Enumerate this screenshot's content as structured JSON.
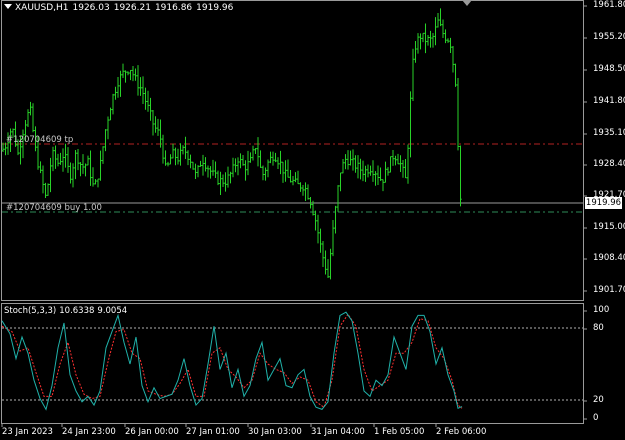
{
  "header": {
    "symbol": "XAUUSD,H1",
    "open": "1926.03",
    "high": "1926.21",
    "low": "1916.86",
    "close": "1919.96"
  },
  "orders": {
    "tp_label": "#120704609 tp",
    "buy_label": "#120704609 buy 1.00"
  },
  "price_axis": {
    "ticks": [
      "1961.80",
      "1955.20",
      "1948.50",
      "1941.80",
      "1935.10",
      "1928.40",
      "1921.70",
      "1915.00",
      "1908.40",
      "1901.70"
    ],
    "current_price": "1919.96"
  },
  "indicator": {
    "name": "Stoch(5,3,3)",
    "main": "10.6338",
    "signal": "9.0054",
    "levels": [
      "100",
      "80",
      "20",
      "0"
    ]
  },
  "time_axis": {
    "ticks": [
      "23 Jan 2023",
      "24 Jan 23:00",
      "26 Jan 00:00",
      "27 Jan 01:00",
      "30 Jan 03:00",
      "31 Jan 04:00",
      "1 Feb 05:00",
      "2 Feb 06:00"
    ]
  },
  "colors": {
    "background": "#000000",
    "bar": "#28d228",
    "tp_line": "#b22222",
    "buy_line": "#2e8b57",
    "stoch_main": "#20b2aa",
    "stoch_signal": "#ff3030"
  },
  "chart_data": {
    "type": "candlestick",
    "symbol": "XAUUSD",
    "timeframe": "H1",
    "ylim": [
      1900.0,
      1962.5
    ],
    "close_path": [
      [
        0,
        1930
      ],
      [
        6,
        1932
      ],
      [
        12,
        1936
      ],
      [
        18,
        1930
      ],
      [
        24,
        1936
      ],
      [
        30,
        1940
      ],
      [
        36,
        1930
      ],
      [
        42,
        1924
      ],
      [
        46,
        1920
      ],
      [
        52,
        1930
      ],
      [
        58,
        1928
      ],
      [
        64,
        1930
      ],
      [
        70,
        1925
      ],
      [
        76,
        1930
      ],
      [
        82,
        1927
      ],
      [
        88,
        1928
      ],
      [
        94,
        1922
      ],
      [
        100,
        1927
      ],
      [
        106,
        1936
      ],
      [
        112,
        1942
      ],
      [
        118,
        1946
      ],
      [
        124,
        1948
      ],
      [
        130,
        1949
      ],
      [
        136,
        1946
      ],
      [
        142,
        1944
      ],
      [
        148,
        1940
      ],
      [
        154,
        1936
      ],
      [
        160,
        1934
      ],
      [
        166,
        1926
      ],
      [
        172,
        1930
      ],
      [
        178,
        1929
      ],
      [
        184,
        1931
      ],
      [
        190,
        1929
      ],
      [
        196,
        1925
      ],
      [
        202,
        1929
      ],
      [
        208,
        1927
      ],
      [
        214,
        1925
      ],
      [
        220,
        1924
      ],
      [
        226,
        1924
      ],
      [
        232,
        1926
      ],
      [
        238,
        1929
      ],
      [
        244,
        1927
      ],
      [
        250,
        1928
      ],
      [
        256,
        1932
      ],
      [
        262,
        1925
      ],
      [
        268,
        1928
      ],
      [
        274,
        1930
      ],
      [
        280,
        1928
      ],
      [
        286,
        1925
      ],
      [
        292,
        1924
      ],
      [
        298,
        1923
      ],
      [
        304,
        1923
      ],
      [
        310,
        1920
      ],
      [
        316,
        1915
      ],
      [
        322,
        1908
      ],
      [
        328,
        1903
      ],
      [
        334,
        1915
      ],
      [
        340,
        1926
      ],
      [
        346,
        1929
      ],
      [
        352,
        1928
      ],
      [
        358,
        1927
      ],
      [
        364,
        1926
      ],
      [
        370,
        1927
      ],
      [
        376,
        1926
      ],
      [
        382,
        1924
      ],
      [
        388,
        1927
      ],
      [
        394,
        1930
      ],
      [
        400,
        1928
      ],
      [
        406,
        1924
      ],
      [
        410,
        1940
      ],
      [
        414,
        1953
      ],
      [
        420,
        1956
      ],
      [
        426,
        1955
      ],
      [
        432,
        1955
      ],
      [
        438,
        1959
      ],
      [
        444,
        1956
      ],
      [
        450,
        1955
      ],
      [
        456,
        1945
      ],
      [
        460,
        1919.96
      ]
    ],
    "orders": [
      {
        "label": "#120704609 tp",
        "price": 1932.3
      },
      {
        "label": "#120704609 buy 1.00",
        "price": 1919.2
      }
    ],
    "current_price": 1919.96,
    "stochastic": {
      "params": "5,3,3",
      "main_last": 10.6338,
      "signal_last": 9.0054,
      "levels": [
        80,
        20
      ],
      "ylim": [
        0,
        100
      ],
      "main_path": [
        [
          0,
          90
        ],
        [
          8,
          78
        ],
        [
          14,
          55
        ],
        [
          20,
          75
        ],
        [
          26,
          60
        ],
        [
          32,
          35
        ],
        [
          38,
          18
        ],
        [
          44,
          8
        ],
        [
          50,
          30
        ],
        [
          56,
          65
        ],
        [
          62,
          88
        ],
        [
          68,
          40
        ],
        [
          74,
          25
        ],
        [
          80,
          15
        ],
        [
          86,
          20
        ],
        [
          92,
          12
        ],
        [
          98,
          25
        ],
        [
          104,
          65
        ],
        [
          110,
          80
        ],
        [
          116,
          95
        ],
        [
          122,
          70
        ],
        [
          128,
          50
        ],
        [
          134,
          75
        ],
        [
          140,
          30
        ],
        [
          146,
          15
        ],
        [
          152,
          28
        ],
        [
          158,
          18
        ],
        [
          164,
          20
        ],
        [
          170,
          22
        ],
        [
          176,
          35
        ],
        [
          182,
          55
        ],
        [
          188,
          30
        ],
        [
          194,
          12
        ],
        [
          200,
          18
        ],
        [
          206,
          50
        ],
        [
          212,
          85
        ],
        [
          218,
          45
        ],
        [
          224,
          60
        ],
        [
          230,
          28
        ],
        [
          236,
          45
        ],
        [
          242,
          20
        ],
        [
          248,
          30
        ],
        [
          254,
          55
        ],
        [
          260,
          70
        ],
        [
          266,
          35
        ],
        [
          272,
          45
        ],
        [
          278,
          55
        ],
        [
          284,
          30
        ],
        [
          290,
          28
        ],
        [
          296,
          40
        ],
        [
          302,
          45
        ],
        [
          308,
          20
        ],
        [
          314,
          10
        ],
        [
          320,
          8
        ],
        [
          326,
          15
        ],
        [
          332,
          60
        ],
        [
          338,
          95
        ],
        [
          344,
          98
        ],
        [
          350,
          90
        ],
        [
          356,
          60
        ],
        [
          362,
          25
        ],
        [
          368,
          20
        ],
        [
          374,
          35
        ],
        [
          380,
          30
        ],
        [
          386,
          40
        ],
        [
          392,
          75
        ],
        [
          398,
          60
        ],
        [
          404,
          45
        ],
        [
          410,
          85
        ],
        [
          416,
          95
        ],
        [
          422,
          95
        ],
        [
          428,
          80
        ],
        [
          434,
          50
        ],
        [
          440,
          65
        ],
        [
          446,
          40
        ],
        [
          452,
          25
        ],
        [
          456,
          9
        ],
        [
          460,
          10.6
        ]
      ],
      "signal_path": [
        [
          0,
          85
        ],
        [
          10,
          80
        ],
        [
          18,
          62
        ],
        [
          26,
          65
        ],
        [
          34,
          42
        ],
        [
          42,
          20
        ],
        [
          50,
          20
        ],
        [
          58,
          50
        ],
        [
          66,
          70
        ],
        [
          74,
          40
        ],
        [
          82,
          22
        ],
        [
          90,
          18
        ],
        [
          98,
          20
        ],
        [
          106,
          52
        ],
        [
          114,
          80
        ],
        [
          122,
          82
        ],
        [
          130,
          60
        ],
        [
          138,
          55
        ],
        [
          146,
          25
        ],
        [
          154,
          22
        ],
        [
          162,
          20
        ],
        [
          170,
          22
        ],
        [
          178,
          32
        ],
        [
          186,
          45
        ],
        [
          194,
          20
        ],
        [
          202,
          20
        ],
        [
          210,
          60
        ],
        [
          218,
          65
        ],
        [
          226,
          45
        ],
        [
          234,
          38
        ],
        [
          242,
          28
        ],
        [
          250,
          35
        ],
        [
          258,
          60
        ],
        [
          266,
          50
        ],
        [
          274,
          45
        ],
        [
          282,
          42
        ],
        [
          290,
          32
        ],
        [
          298,
          38
        ],
        [
          306,
          35
        ],
        [
          314,
          15
        ],
        [
          322,
          10
        ],
        [
          330,
          35
        ],
        [
          338,
          85
        ],
        [
          346,
          96
        ],
        [
          354,
          85
        ],
        [
          362,
          45
        ],
        [
          370,
          25
        ],
        [
          378,
          30
        ],
        [
          386,
          35
        ],
        [
          394,
          60
        ],
        [
          402,
          60
        ],
        [
          410,
          70
        ],
        [
          418,
          92
        ],
        [
          426,
          90
        ],
        [
          434,
          65
        ],
        [
          442,
          55
        ],
        [
          450,
          35
        ],
        [
          456,
          12
        ],
        [
          460,
          9.0
        ]
      ]
    }
  }
}
